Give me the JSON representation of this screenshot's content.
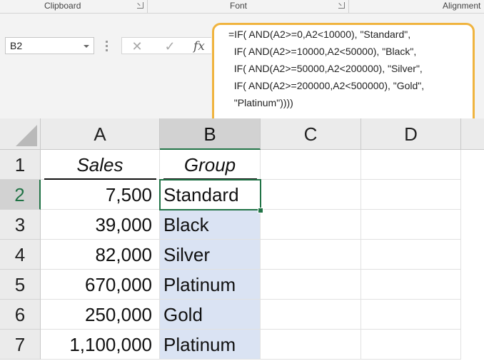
{
  "ribbon": {
    "groups": [
      "Clipboard",
      "Font",
      "Alignment"
    ]
  },
  "formula_bar": {
    "name_box": "B2",
    "cancel_glyph": "✕",
    "enter_glyph": "✓",
    "fx_label": "fx",
    "formula_lines": [
      "=IF( AND(A2>=0,A2<10000), \"Standard\",",
      "  IF( AND(A2>=10000,A2<50000), \"Black\",",
      "  IF( AND(A2>=50000,A2<200000), \"Silver\",",
      "  IF( AND(A2>=200000,A2<500000), \"Gold\",",
      "  \"Platinum\"))))"
    ],
    "highlight_color": "#f0b43f"
  },
  "sheet": {
    "columns": [
      "A",
      "B",
      "C",
      "D"
    ],
    "rows": [
      "1",
      "2",
      "3",
      "4",
      "5",
      "6",
      "7"
    ],
    "header_row": {
      "sales": "Sales",
      "group": "Group"
    },
    "data": [
      {
        "sales": "7,500",
        "group": "Standard"
      },
      {
        "sales": "39,000",
        "group": "Black"
      },
      {
        "sales": "82,000",
        "group": "Silver"
      },
      {
        "sales": "670,000",
        "group": "Platinum"
      },
      {
        "sales": "250,000",
        "group": "Gold"
      },
      {
        "sales": "1,100,000",
        "group": "Platinum"
      }
    ],
    "active_cell": "B2",
    "selection_color": "#dae3f3",
    "accent_color": "#217346"
  }
}
